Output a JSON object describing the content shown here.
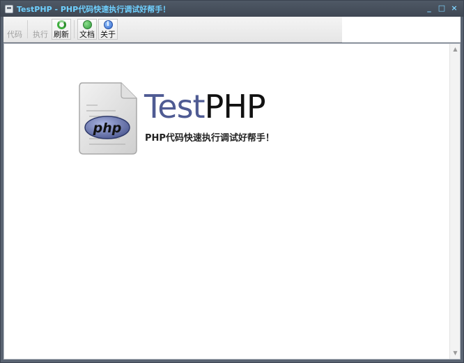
{
  "window": {
    "title": "TestPHP - PHP代码快速执行调试好帮手！",
    "controls": {
      "minimize": "_",
      "maximize": "□",
      "close": "×"
    }
  },
  "toolbar": {
    "items": [
      {
        "label": "代码",
        "icon": "code-icon",
        "enabled": false
      },
      {
        "label": "执行",
        "icon": "run-icon",
        "enabled": false
      },
      {
        "label": "刷新",
        "icon": "refresh-icon",
        "enabled": true
      },
      {
        "label": "文档",
        "icon": "docs-icon",
        "enabled": true
      },
      {
        "label": "关于",
        "icon": "about-icon",
        "enabled": true
      }
    ]
  },
  "splash": {
    "logo_text": "php",
    "brand_test": "Test",
    "brand_php": "PHP",
    "tagline": "PHP代码快速执行调试好帮手！"
  },
  "colors": {
    "title_text": "#6fd0ff",
    "brand_test": "#4f5b93",
    "brand_php": "#111111",
    "php_logo": "#6b78b4"
  }
}
